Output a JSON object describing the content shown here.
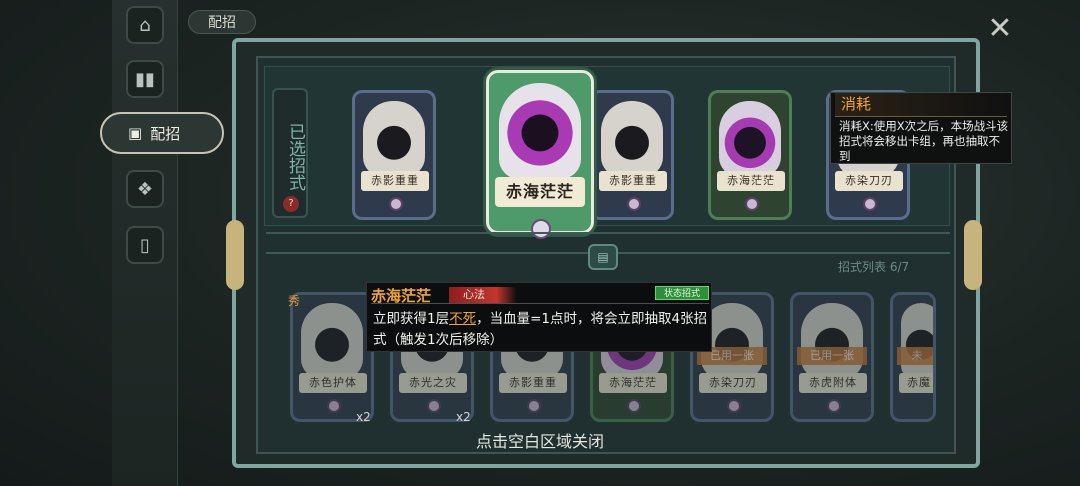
{
  "header": {
    "title": "配招",
    "close_icon": "close-icon"
  },
  "nav": {
    "items": [
      {
        "name": "castle-icon"
      },
      {
        "name": "cards-icon"
      },
      {
        "name": "deck-icon",
        "label": "配招",
        "active": true
      },
      {
        "name": "lotus-icon"
      },
      {
        "name": "card-single-icon"
      }
    ]
  },
  "selected": {
    "label": "已选招式",
    "help_badge": "?",
    "cards": [
      {
        "name": "赤影重重"
      },
      {
        "name": "赤海茫茫",
        "featured": true
      },
      {
        "name": "赤影重重"
      },
      {
        "name": "赤海茫茫"
      },
      {
        "name": "赤染刀刃"
      }
    ]
  },
  "tooltip": {
    "title": "消耗",
    "body": "消耗X:使用X次之后，本场战斗该招式将会移出卡组，再也抽取不到"
  },
  "list": {
    "label": "招式列表 6/7",
    "cards": [
      {
        "name": "赤色护体",
        "count": "x2",
        "badge": "秀"
      },
      {
        "name": "赤光之灾",
        "count": "x2"
      },
      {
        "name": "赤影重重"
      },
      {
        "name": "赤海茫茫"
      },
      {
        "name": "赤染刀刃",
        "used": "已用一张"
      },
      {
        "name": "赤虎附体",
        "used": "已用一张"
      },
      {
        "name": "赤魔",
        "used": "未"
      }
    ]
  },
  "popup": {
    "title": "赤海茫茫",
    "tag": "心法",
    "status": "状态招式",
    "body_pre": "立即获得1层",
    "body_highlight": "不死",
    "body_post": "，当血量=1点时，将会立即抽取4张招式（触发1次后移除）"
  },
  "hint": "点击空白区域关闭"
}
